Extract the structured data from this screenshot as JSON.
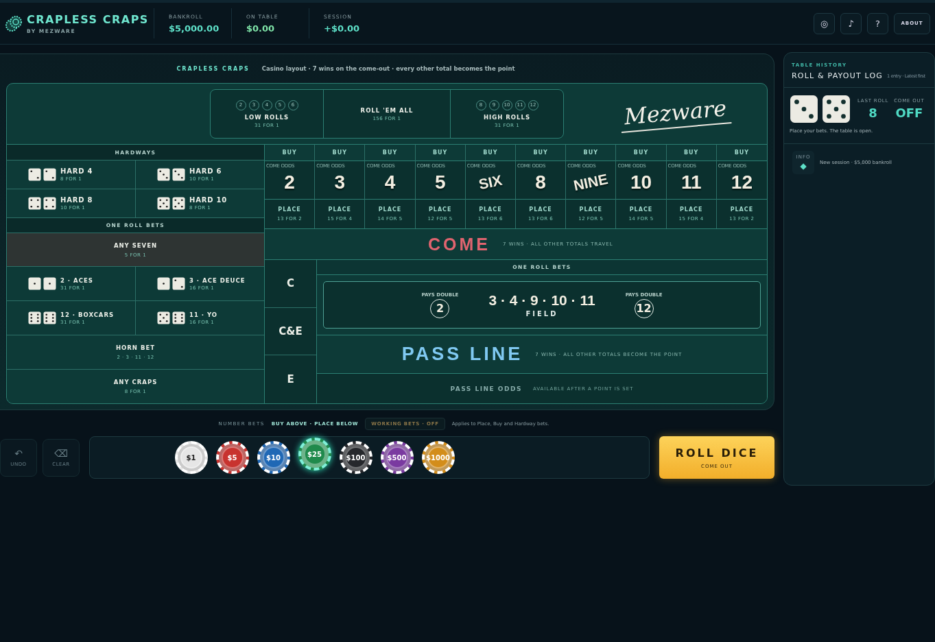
{
  "header": {
    "title": "CRAPLESS CRAPS",
    "subtitle": "BY MEZWARE",
    "stats": [
      {
        "label": "BANKROLL",
        "value": "$5,000.00"
      },
      {
        "label": "ON TABLE",
        "value": "$0.00"
      },
      {
        "label": "SESSION",
        "value": "+$0.00"
      }
    ],
    "buttons": [
      {
        "kind": "icon",
        "label": "◎"
      },
      {
        "kind": "icon",
        "label": "♪"
      },
      {
        "kind": "icon",
        "label": "?"
      },
      {
        "kind": "text",
        "label": "ABOUT"
      }
    ]
  },
  "table": {
    "title": "CRAPLESS CRAPS",
    "subtitle": "Casino layout · 7 wins on the come-out · every other total becomes the point",
    "props": [
      {
        "numbers": [
          "2",
          "3",
          "4",
          "5",
          "6"
        ],
        "name": "LOW ROLLS",
        "payout": "31 FOR 1"
      },
      {
        "name": "ROLL 'EM ALL",
        "payout": "156 FOR 1"
      },
      {
        "numbers": [
          "8",
          "9",
          "10",
          "11",
          "12"
        ],
        "name": "HIGH ROLLS",
        "payout": "31 FOR 1"
      }
    ],
    "logo": "Mezware",
    "hardways": {
      "title": "HARDWAYS",
      "bets": [
        {
          "dice": [
            {
              "kind": "two"
            },
            {
              "kind": "two"
            }
          ],
          "name": "HARD 4",
          "payout": "8 FOR 1"
        },
        {
          "dice": [
            {
              "kind": "three"
            },
            {
              "kind": "three"
            }
          ],
          "name": "HARD 6",
          "payout": "10 FOR 1"
        },
        {
          "dice": [
            {
              "kind": "four"
            },
            {
              "kind": "four"
            }
          ],
          "name": "HARD 8",
          "payout": "10 FOR 1"
        },
        {
          "dice": [
            {
              "kind": "five"
            },
            {
              "kind": "five"
            }
          ],
          "name": "HARD 10",
          "payout": "8 FOR 1"
        }
      ]
    },
    "one_roll": {
      "title": "ONE ROLL BETS",
      "bets": [
        {
          "kind": "wide",
          "name": "ANY SEVEN",
          "payout": "5 FOR 1",
          "highlighted": true
        },
        {
          "kind": "dice",
          "dice": [
            {
              "kind": "one"
            },
            {
              "kind": "one"
            }
          ],
          "name": "2 · ACES",
          "payout": "31 FOR 1"
        },
        {
          "kind": "dice",
          "dice": [
            {
              "kind": "one"
            },
            {
              "kind": "two"
            }
          ],
          "name": "3 · ACE DEUCE",
          "payout": "16 FOR 1"
        },
        {
          "kind": "dice",
          "dice": [
            {
              "kind": "six"
            },
            {
              "kind": "six"
            }
          ],
          "name": "12 · BOXCARS",
          "payout": "31 FOR 1"
        },
        {
          "kind": "dice",
          "dice": [
            {
              "kind": "five"
            },
            {
              "kind": "six"
            }
          ],
          "name": "11 · YO",
          "payout": "16 FOR 1"
        },
        {
          "kind": "wide",
          "name": "HORN BET",
          "payout": "2 · 3 · 11 · 12",
          "highlighted": false
        },
        {
          "kind": "wide",
          "name": "ANY CRAPS",
          "payout": "8 FOR 1",
          "highlighted": false
        }
      ]
    },
    "numbers": [
      {
        "buy": "BUY",
        "odds": "COME ODDS",
        "kind": "digit",
        "number": "2",
        "place": "PLACE",
        "place_payout": "13 FOR 2"
      },
      {
        "buy": "BUY",
        "odds": "COME ODDS",
        "kind": "digit",
        "number": "3",
        "place": "PLACE",
        "place_payout": "15 FOR 4"
      },
      {
        "buy": "BUY",
        "odds": "COME ODDS",
        "kind": "digit",
        "number": "4",
        "place": "PLACE",
        "place_payout": "14 FOR 5"
      },
      {
        "buy": "BUY",
        "odds": "COME ODDS",
        "kind": "digit",
        "number": "5",
        "place": "PLACE",
        "place_payout": "12 FOR 5"
      },
      {
        "buy": "BUY",
        "odds": "COME ODDS",
        "kind": "word",
        "number": "SIX",
        "place": "PLACE",
        "place_payout": "13 FOR 6"
      },
      {
        "buy": "BUY",
        "odds": "COME ODDS",
        "kind": "digit",
        "number": "8",
        "place": "PLACE",
        "place_payout": "13 FOR 6"
      },
      {
        "buy": "BUY",
        "odds": "COME ODDS",
        "kind": "word",
        "number": "NINE",
        "place": "PLACE",
        "place_payout": "12 FOR 5"
      },
      {
        "buy": "BUY",
        "odds": "COME ODDS",
        "kind": "digit",
        "number": "10",
        "place": "PLACE",
        "place_payout": "14 FOR 5"
      },
      {
        "buy": "BUY",
        "odds": "COME ODDS",
        "kind": "digit",
        "number": "11",
        "place": "PLACE",
        "place_payout": "15 FOR 4"
      },
      {
        "buy": "BUY",
        "odds": "COME ODDS",
        "kind": "digit",
        "number": "12",
        "place": "PLACE",
        "place_payout": "13 FOR 2"
      }
    ],
    "come": {
      "label": "COME",
      "note": "7 WINS · ALL OTHER TOTALS TRAVEL"
    },
    "ce": [
      "C",
      "C&E",
      "E"
    ],
    "field": {
      "title": "ONE ROLL BETS",
      "left": {
        "note": "PAYS DOUBLE",
        "number": "2"
      },
      "numbers": "3 · 4 · 9 · 10 · 11",
      "label": "FIELD",
      "right": {
        "note": "PAYS DOUBLE",
        "number": "12"
      }
    },
    "pass_line": {
      "label": "PASS LINE",
      "note": "7 WINS · ALL OTHER TOTALS BECOME THE POINT"
    },
    "pass_odds": {
      "label": "PASS LINE ODDS",
      "note": "AVAILABLE AFTER A POINT IS SET"
    }
  },
  "controls": {
    "toggles": {
      "label": "NUMBER BETS",
      "mode": "BUY ABOVE · PLACE BELOW",
      "working": {
        "label": "WORKING BETS · OFF",
        "on": false
      },
      "note": "Applies to Place, Buy and Hardway bets."
    },
    "actions": [
      {
        "icon": "↶",
        "label": "UNDO",
        "disabled": true
      },
      {
        "icon": "⌫",
        "label": "CLEAR",
        "disabled": true
      }
    ],
    "chips": [
      {
        "label": "$1",
        "color": "#e6e6e6",
        "selected": false
      },
      {
        "label": "$5",
        "color": "#c8332f",
        "selected": false
      },
      {
        "label": "$10",
        "color": "#1f68b5",
        "selected": false
      },
      {
        "label": "$25",
        "color": "#1f8a4c",
        "selected": true
      },
      {
        "label": "$100",
        "color": "#26282c",
        "selected": false
      },
      {
        "label": "$500",
        "color": "#7a3aa0",
        "selected": false
      },
      {
        "label": "$1000",
        "color": "#d38d1a",
        "selected": false
      }
    ],
    "roll": {
      "label": "ROLL DICE",
      "sub": "COME OUT"
    }
  },
  "history": {
    "eyebrow": "TABLE HISTORY",
    "title": "ROLL & PAYOUT LOG",
    "meta": "1 entry · Latest first",
    "dice": [
      {
        "kind": "three"
      },
      {
        "kind": "five"
      }
    ],
    "last_roll": {
      "label": "LAST ROLL",
      "value": "8"
    },
    "come_out": {
      "label": "COME OUT",
      "value": "OFF"
    },
    "status": "Place your bets. The table is open.",
    "entries": [
      {
        "kind": "info",
        "tag": "INFO",
        "icon": "◆",
        "text": "New session · $5,000 bankroll"
      }
    ]
  }
}
